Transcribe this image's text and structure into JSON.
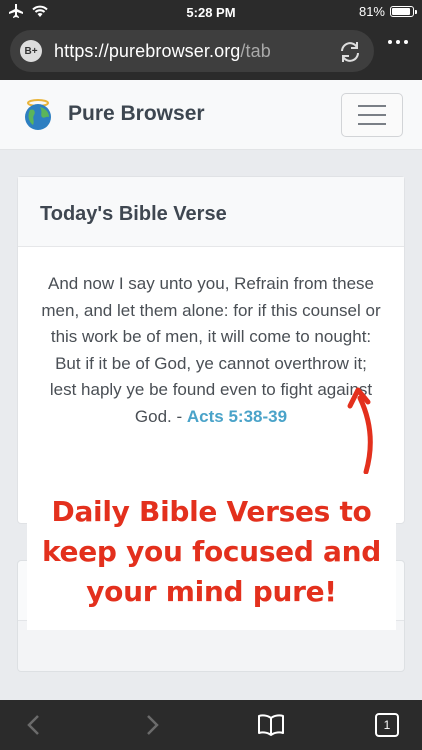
{
  "status_bar": {
    "time": "5:28 PM",
    "battery": "81%",
    "battery_level": 0.81
  },
  "browser": {
    "badge": "B+",
    "url_host": "https://purebrowser.org",
    "url_path": "/tab",
    "open_tabs": "1"
  },
  "site": {
    "brand": "Pure Browser"
  },
  "verse_card": {
    "title": "Today's Bible Verse",
    "verse": "And now I say unto you, Refrain from these men, and let them alone: for if this counsel or this work be of men, it will come to nought: But if it be of God, ye cannot overthrow it; lest haply ye be found even to fight against God. - ",
    "reference": "Acts 5:38-39"
  },
  "promo": {
    "line1": "Daily Bible Verses to",
    "line2": "keep you focused and",
    "line3": "your mind pure!"
  },
  "colors": {
    "promo_red": "#e3301d",
    "link_blue": "#4aa3c9",
    "chrome_dark": "#2b2b2b"
  }
}
